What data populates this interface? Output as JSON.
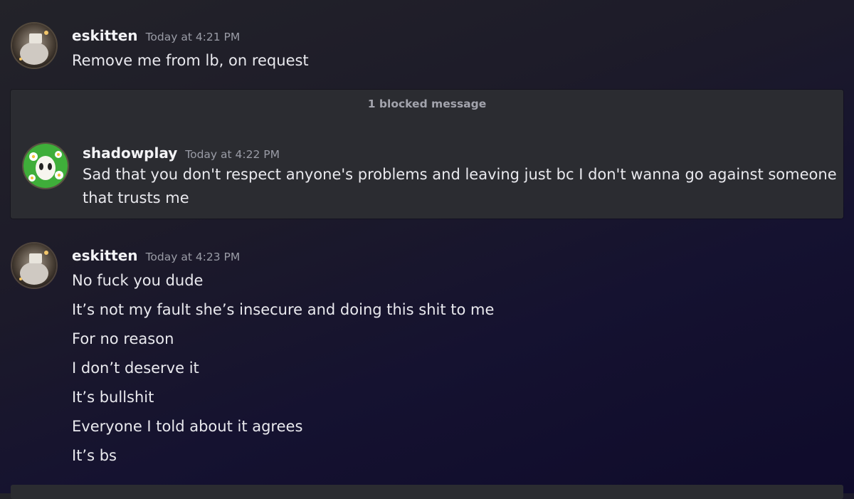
{
  "messages": [
    {
      "username": "eskitten",
      "timestamp": "Today at 4:21 PM",
      "lines": [
        "Remove me from lb, on request"
      ]
    },
    {
      "blocked_label": "1 blocked message",
      "username": "shadowplay",
      "timestamp": "Today at 4:22 PM",
      "lines": [
        "Sad that you don't respect anyone's problems and leaving just bc I don't wanna go against someone",
        "that trusts me"
      ]
    },
    {
      "username": "eskitten",
      "timestamp": "Today at 4:23 PM",
      "lines": [
        "No fuck you dude",
        "It’s not my fault she’s insecure and doing this shit to me",
        "For no reason",
        "I don’t deserve it",
        "It’s bullshit",
        "Everyone I told about it agrees",
        "It’s bs"
      ]
    }
  ],
  "colors": {
    "panel": "#2b2c31",
    "timestamp": "#9a9ca6",
    "avatar_green": "#3fae3a"
  }
}
